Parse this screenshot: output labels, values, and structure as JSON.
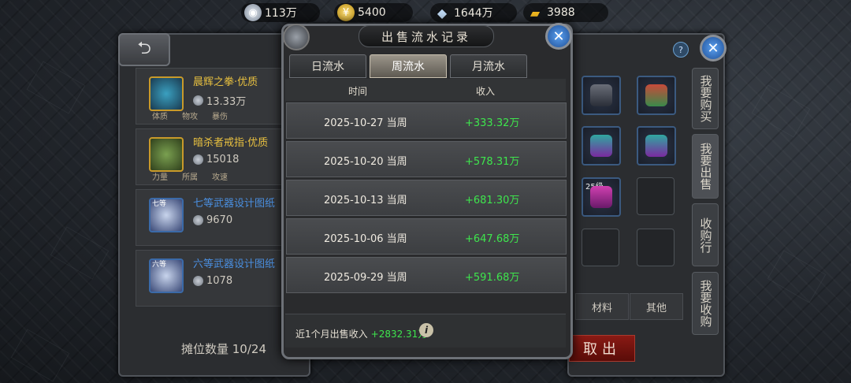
{
  "resources": [
    {
      "icon": "silver-coin-icon",
      "value": "113万",
      "color": "#b8c4d4"
    },
    {
      "icon": "gold-coin-icon",
      "value": "5400",
      "color": "#e8b820"
    },
    {
      "icon": "diamond-icon",
      "value": "1644万",
      "color": "#9fc0e0"
    },
    {
      "icon": "gold-bar-icon",
      "value": "3988",
      "color": "#e0a818"
    }
  ],
  "left_panel": {
    "items": [
      {
        "name": "晨辉之拳",
        "quality": "·优质",
        "price": "13.33万",
        "attrs": [
          "体质",
          "物攻",
          "暴伤"
        ],
        "color": "#e8c040"
      },
      {
        "name": "暗杀者戒指",
        "quality": "·优质",
        "price": "15018",
        "attrs": [
          "力量",
          "所属",
          "攻速"
        ],
        "color": "#e8c040"
      },
      {
        "name": "七等武器设计图纸",
        "quality": "",
        "price": "9670",
        "attrs": [],
        "color": "#4a8fe0"
      },
      {
        "name": "六等武器设计图纸",
        "quality": "",
        "price": "1078",
        "attrs": [],
        "color": "#4a8fe0"
      }
    ],
    "item_badges": [
      "",
      "",
      "七等",
      "六等"
    ],
    "stall_count": "摊位数量 10/24"
  },
  "modal": {
    "title": "出售流水记录",
    "tabs": [
      "日流水",
      "周流水",
      "月流水"
    ],
    "active_tab": 1,
    "columns": [
      "时间",
      "收入"
    ],
    "rows": [
      {
        "date": "2025-10-27 当周",
        "income": "+333.32万"
      },
      {
        "date": "2025-10-20 当周",
        "income": "+578.31万"
      },
      {
        "date": "2025-10-13 当周",
        "income": "+681.30万"
      },
      {
        "date": "2025-10-06 当周",
        "income": "+647.68万"
      },
      {
        "date": "2025-09-29 当周",
        "income": "+591.68万"
      }
    ],
    "summary_label": "近1个月出售收入",
    "summary_value": "+2832.31万",
    "info_glyph": "i",
    "close_glyph": "✕"
  },
  "right_panel": {
    "side_tabs": [
      "我要购买",
      "我要出售",
      "收购行",
      "我要收购"
    ],
    "active_side_tab": 1,
    "categories": [
      "材料",
      "其他"
    ],
    "cancel_label": "取出",
    "slot_level": "25级",
    "help_glyph": "?"
  },
  "colors": {
    "accent_green": "#3ee64d",
    "quality_gold": "#e8c040",
    "blueprint_blue": "#4a8fe0",
    "cancel_red": "#8a1a14"
  }
}
